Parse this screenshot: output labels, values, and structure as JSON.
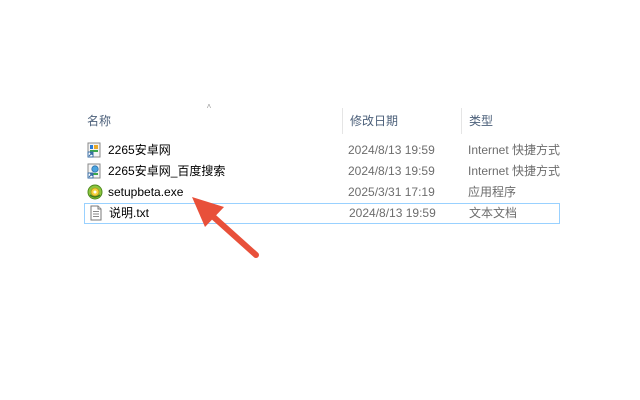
{
  "columns": {
    "name": "名称",
    "date": "修改日期",
    "type": "类型"
  },
  "files": [
    {
      "name": "2265安卓网",
      "date": "2024/8/13 19:59",
      "type": "Internet 快捷方式",
      "icon": "internet-shortcut-icon"
    },
    {
      "name": "2265安卓网_百度搜索",
      "date": "2024/8/13 19:59",
      "type": "Internet 快捷方式",
      "icon": "internet-shortcut-icon"
    },
    {
      "name": "setupbeta.exe",
      "date": "2025/3/31 17:19",
      "type": "应用程序",
      "icon": "installer-icon"
    },
    {
      "name": "说明.txt",
      "date": "2024/8/13 19:59",
      "type": "文本文档",
      "icon": "text-file-icon"
    }
  ],
  "colors": {
    "annotation_arrow": "#e8503a",
    "focus_border": "#99d1ff",
    "header_text": "#4c607a"
  }
}
